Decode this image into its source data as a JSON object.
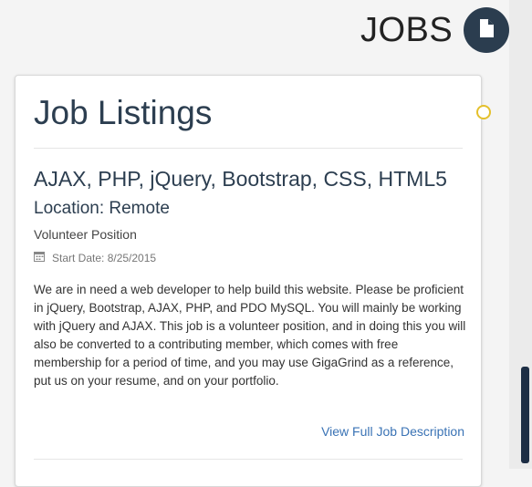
{
  "header": {
    "title": "JOBS",
    "doc_icon": "document-icon"
  },
  "card": {
    "title": "Job Listings"
  },
  "job": {
    "title": "AJAX, PHP, jQuery, Bootstrap, CSS, HTML5",
    "location": "Location: Remote",
    "type": "Volunteer Position",
    "start_date": "Start Date: 8/25/2015",
    "calendar_icon": "calendar-icon",
    "description": "We are in need a web developer to help build this website. Please be proficient in jQuery, Bootstrap, AJAX, PHP, and PDO MySQL. You will mainly be working with jQuery and AJAX. This job is a volunteer position, and in doing this you will also be converted to a contributing member, which comes with free membership for a period of time, and you may use GigaGrind as a reference, put us on your resume, and on your portfolio.",
    "view_link": "View Full Job Description"
  },
  "colors": {
    "accent_dark": "#2b3d4f",
    "link": "#3a73b5",
    "ring": "#e4c02c"
  }
}
